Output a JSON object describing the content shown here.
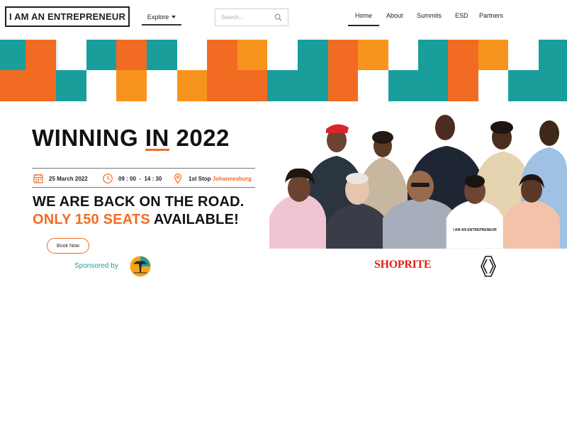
{
  "header": {
    "logo_text": "I AM AN ENTREPRENEUR",
    "explore_label": "Explore",
    "search_placeholder": "Search...",
    "nav": [
      {
        "label": "Home",
        "active": true
      },
      {
        "label": "About",
        "active": false
      },
      {
        "label": "Summits",
        "active": false
      },
      {
        "label": "ESD",
        "active": false
      },
      {
        "label": "Partners",
        "active": false
      }
    ]
  },
  "hero": {
    "title_pre": "WINNING ",
    "title_in": "IN",
    "title_post": " 2022",
    "date": "25 March 2022",
    "time": "09 : 00  -  14 : 30",
    "stop_prefix": "1st Stop",
    "stop_city": "Johannesburg",
    "line1": "WE ARE BACK ON THE ROAD.",
    "line2_highlight": "ONLY 150 SEATS",
    "line2_rest": " AVAILABLE!",
    "book_label": "Book Now",
    "sponsored_label": "Sponsored by",
    "photo_shirt_text": "I AM AN ENTREPRENEUR"
  },
  "sponsors": {
    "shoprite": "SHOPRITE"
  },
  "colors": {
    "teal": "#1a9e9b",
    "orange": "#f26b23",
    "amber": "#f7941d",
    "shoprite_red": "#e0201b"
  },
  "icons": [
    "search-icon",
    "caret-down-icon",
    "calendar-icon",
    "clock-icon",
    "location-pin-icon",
    "fnb-tree-logo",
    "renault-logo"
  ]
}
